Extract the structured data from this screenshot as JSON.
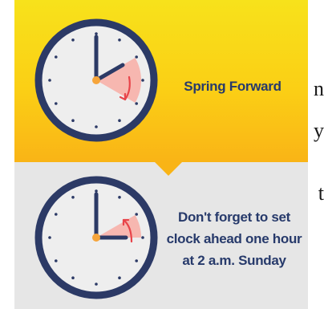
{
  "edge_text": {
    "letter_1": "n",
    "letter_2": "y",
    "letter_3": "t"
  },
  "top_panel": {
    "caption": "Spring Forward",
    "background": "#fbcf15",
    "clock": {
      "hour": 2,
      "minute": 0,
      "shaded_arc_to_minute": 20,
      "arrow_direction": "clockwise"
    }
  },
  "bottom_panel": {
    "caption_lines": [
      "Don't forget to set",
      "clock ahead one hour",
      "at 2 a.m. Sunday"
    ],
    "background": "#e6e6e6",
    "clock": {
      "hour": 3,
      "minute": 0,
      "shaded_arc_from_minute": 50,
      "arrow_direction": "counterclockwise"
    }
  },
  "colors": {
    "clock_ring": "#2c3a66",
    "clock_face": "#eeeeee",
    "hands": "#2c3a66",
    "center_dot": "#f6a53b",
    "shading": "#f7b7b0",
    "arrow": "#e8444a",
    "caption": "#273a6b"
  }
}
